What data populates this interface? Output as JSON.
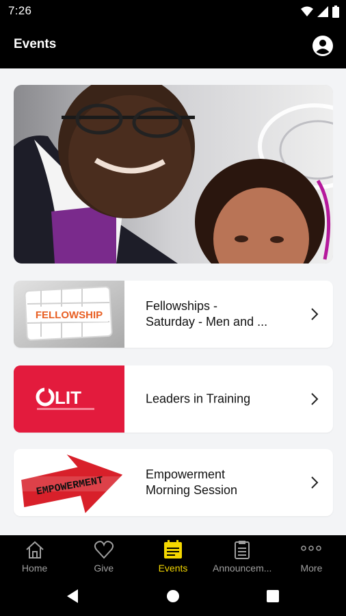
{
  "status_bar": {
    "time": "7:26"
  },
  "app_bar": {
    "title": "Events"
  },
  "events": [
    {
      "title_line1": "Fellowships -",
      "title_line2": "Saturday - Men and ...",
      "thumb_text": "FELLOWSHIP"
    },
    {
      "title_line1": "Leaders in Training",
      "title_line2": "",
      "thumb_text": "LIT"
    },
    {
      "title_line1": "Empowerment",
      "title_line2": "Morning Session",
      "thumb_text": "EMPOWERMENT"
    }
  ],
  "nav": {
    "items": [
      {
        "label": "Home",
        "icon": "home-icon"
      },
      {
        "label": "Give",
        "icon": "heart-icon"
      },
      {
        "label": "Events",
        "icon": "events-icon",
        "active": true
      },
      {
        "label": "Announcem...",
        "icon": "clipboard-icon"
      },
      {
        "label": "More",
        "icon": "more-icon"
      }
    ]
  },
  "colors": {
    "accent": "#f5d800",
    "lit_red": "#e31b3d",
    "empowerment_red": "#d8202a"
  }
}
